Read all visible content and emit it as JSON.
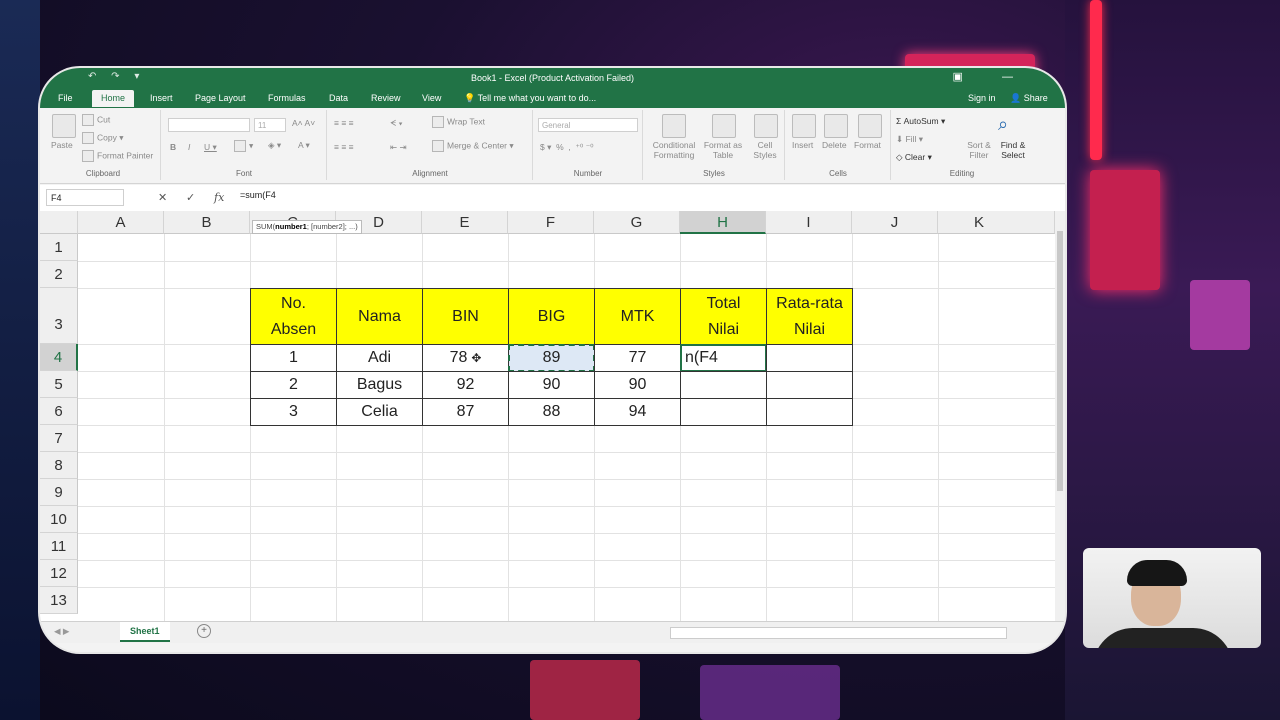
{
  "window": {
    "title": "Book1 - Excel (Product Activation Failed)",
    "brand_color": "#217346"
  },
  "menu": {
    "tabs": [
      "File",
      "Home",
      "Insert",
      "Page Layout",
      "Formulas",
      "Data",
      "Review",
      "View"
    ],
    "active": "Home",
    "tell_me": "Tell me what you want to do...",
    "sign_in": "Sign in",
    "share": "Share"
  },
  "ribbon": {
    "clipboard": {
      "paste": "Paste",
      "cut": "Cut",
      "copy": "Copy",
      "format_painter": "Format Painter",
      "label": "Clipboard"
    },
    "font": {
      "size": "11",
      "label": "Font"
    },
    "alignment": {
      "wrap_text": "Wrap Text",
      "merge_center": "Merge & Center",
      "label": "Alignment"
    },
    "number": {
      "format": "General",
      "label": "Number"
    },
    "styles": {
      "conditional": "Conditional Formatting",
      "format_table": "Format as Table",
      "cell_styles": "Cell Styles",
      "label": "Styles"
    },
    "cells": {
      "insert": "Insert",
      "delete": "Delete",
      "format": "Format",
      "label": "Cells"
    },
    "editing": {
      "autosum": "AutoSum",
      "fill": "Fill",
      "clear": "Clear",
      "sort_filter": "Sort & Filter",
      "find_select": "Find & Select",
      "label": "Editing"
    }
  },
  "formula_bar": {
    "name_box": "F4",
    "fx": "fx",
    "formula": "=sum(F4",
    "tooltip_prefix": "SUM(",
    "tooltip_bold": "number1",
    "tooltip_rest": "; [number2]; ...)"
  },
  "sheet": {
    "columns": [
      "A",
      "B",
      "C",
      "D",
      "E",
      "F",
      "G",
      "H",
      "I",
      "J",
      "K"
    ],
    "rows": [
      "1",
      "2",
      "3",
      "4",
      "5",
      "6",
      "7",
      "8",
      "9",
      "10",
      "11",
      "12",
      "13"
    ],
    "active_col": "H",
    "active_row": "4",
    "table_headers": {
      "no_absen_1": "No.",
      "no_absen_2": "Absen",
      "nama": "Nama",
      "bin": "BIN",
      "big": "BIG",
      "mtk": "MTK",
      "total_1": "Total",
      "total_2": "Nilai",
      "rata_1": "Rata-rata",
      "rata_2": "Nilai"
    },
    "table_rows": [
      {
        "no": "1",
        "nama": "Adi",
        "bin": "78",
        "big": "89",
        "mtk": "77",
        "total": "n(F4",
        "rata": ""
      },
      {
        "no": "2",
        "nama": "Bagus",
        "bin": "92",
        "big": "90",
        "mtk": "90",
        "total": "",
        "rata": ""
      },
      {
        "no": "3",
        "nama": "Celia",
        "bin": "87",
        "big": "88",
        "mtk": "94",
        "total": "",
        "rata": ""
      }
    ],
    "header_fill": "#ffff00"
  },
  "tabs": {
    "sheet1": "Sheet1",
    "add": "+"
  }
}
